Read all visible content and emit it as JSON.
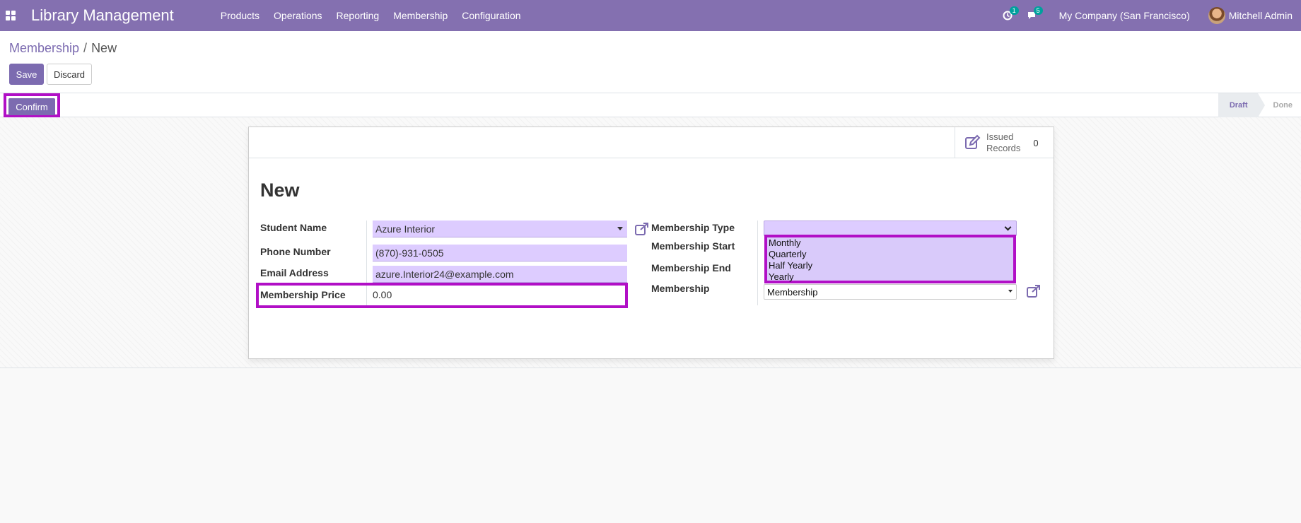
{
  "navbar": {
    "app_title": "Library Management",
    "menu": [
      "Products",
      "Operations",
      "Reporting",
      "Membership",
      "Configuration"
    ],
    "activity_count": "1",
    "message_count": "5",
    "company": "My Company (San Francisco)",
    "user": "Mitchell Admin",
    "bg_color": "#8470b0"
  },
  "breadcrumb": {
    "parent": "Membership",
    "current": "New"
  },
  "buttons": {
    "save": "Save",
    "discard": "Discard",
    "confirm": "Confirm"
  },
  "status": {
    "steps": [
      "Draft",
      "Done"
    ],
    "active": "Draft"
  },
  "stat_button": {
    "label_line1": "Issued",
    "label_line2": "Records",
    "value": "0"
  },
  "form": {
    "title": "New",
    "left": {
      "student_name_label": "Student Name",
      "student_name_value": "Azure Interior",
      "phone_label": "Phone Number",
      "phone_value": "(870)-931-0505",
      "email_label": "Email Address",
      "email_value": "azure.Interior24@example.com",
      "price_label": "Membership Price",
      "price_value": "0.00"
    },
    "right": {
      "type_label": "Membership Type",
      "start_label": "Membership Start",
      "end_label": "Membership End",
      "membership_label": "Membership",
      "type_options": [
        "Monthly",
        "Quarterly",
        "Half Yearly",
        "Yearly"
      ],
      "membership_value": "Membership"
    }
  },
  "colors": {
    "accent": "#7c6bb0",
    "highlight": "#b10fc6",
    "field_bg": "#ddccff"
  }
}
